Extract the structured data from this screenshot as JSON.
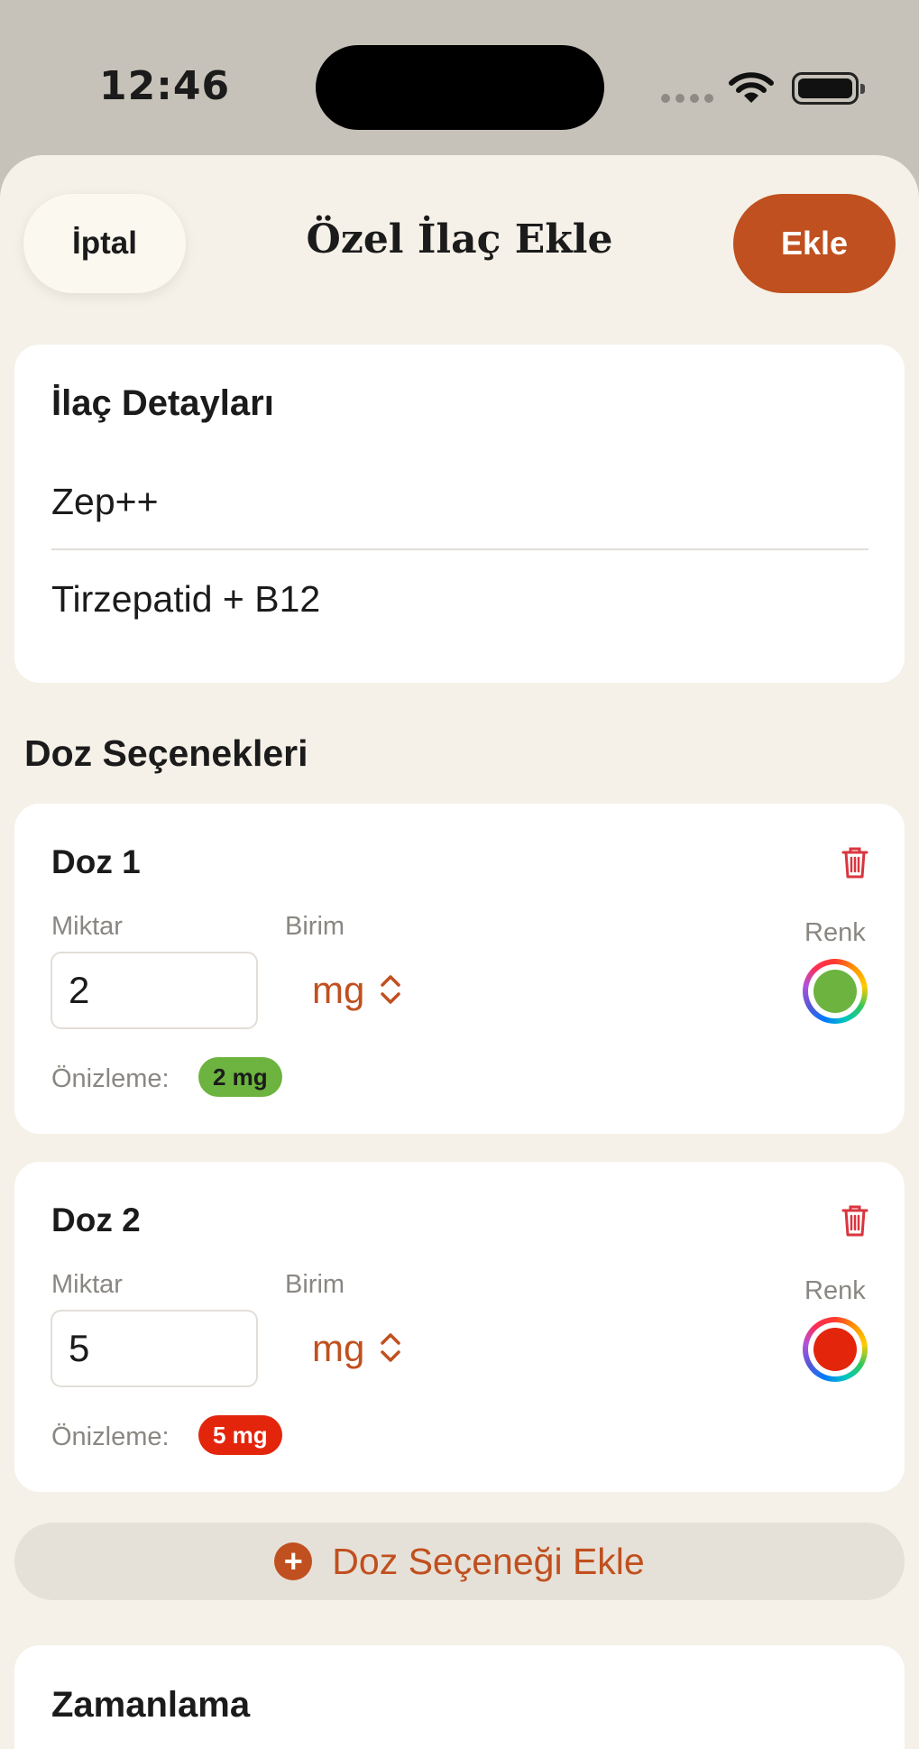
{
  "status_bar": {
    "time": "12:46"
  },
  "header": {
    "cancel_label": "İptal",
    "title": "Özel İlaç Ekle",
    "add_label": "Ekle"
  },
  "details": {
    "title": "İlaç Detayları",
    "name_value": "Zep++",
    "ingredient_value": "Tirzepatid + B12"
  },
  "doses_section": {
    "title": "Doz Seçenekleri",
    "doses": [
      {
        "title": "Doz 1",
        "amount_label": "Miktar",
        "amount_value": "2",
        "unit_label": "Birim",
        "unit_value": "mg",
        "color_label": "Renk",
        "color": "#6cb33f",
        "preview_label": "Önizleme:",
        "preview_chip": "2 mg"
      },
      {
        "title": "Doz 2",
        "amount_label": "Miktar",
        "amount_value": "5",
        "unit_label": "Birim",
        "unit_value": "mg",
        "color_label": "Renk",
        "color": "#e3250c",
        "preview_label": "Önizleme:",
        "preview_chip": "5 mg"
      }
    ],
    "add_dose_label": "Doz Seçeneği Ekle"
  },
  "timing": {
    "title": "Zamanlama"
  },
  "colors": {
    "accent": "#c0501f",
    "background": "#f5f1e8",
    "danger": "#d9363e"
  },
  "icons": [
    "wifi-icon",
    "battery-icon",
    "trash-icon",
    "chevron-updown-icon",
    "plus-circle-icon",
    "color-picker-icon"
  ]
}
